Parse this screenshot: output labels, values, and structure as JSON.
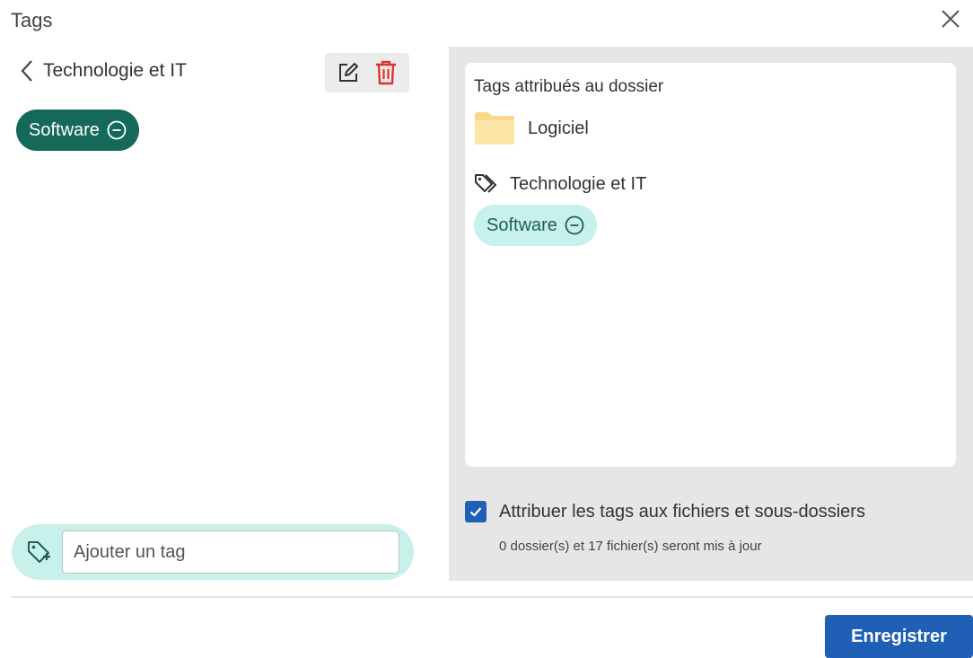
{
  "dialog": {
    "title": "Tags",
    "close_icon": "close-icon"
  },
  "left_pane": {
    "back_label": "Technologie et IT",
    "back_icon": "chevron-left-icon",
    "edit_icon": "edit-icon",
    "delete_icon": "trash-icon",
    "selected_tags": [
      {
        "label": "Software",
        "icon": "minus-circle-icon"
      }
    ],
    "add_tag": {
      "icon": "tag-plus-icon",
      "placeholder": "Ajouter un tag",
      "value": ""
    }
  },
  "right_pane": {
    "card_title": "Tags attribués au dossier",
    "folder": {
      "icon": "folder-icon",
      "name": "Logiciel"
    },
    "category": {
      "icon": "tags-icon",
      "name": "Technologie et IT"
    },
    "assigned_tags": [
      {
        "label": "Software",
        "icon": "minus-circle-icon"
      }
    ],
    "apply_checkbox": {
      "checked": true,
      "label": "Attribuer les tags aux fichiers et sous-dossiers",
      "note": "0 dossier(s) et 17 fichier(s) seront mis à jour"
    }
  },
  "footer": {
    "save_label": "Enregistrer"
  },
  "colors": {
    "chip_dark": "#14695a",
    "chip_light": "#c7f1ec",
    "primary": "#1f5fb6",
    "delete": "#e0312f"
  }
}
